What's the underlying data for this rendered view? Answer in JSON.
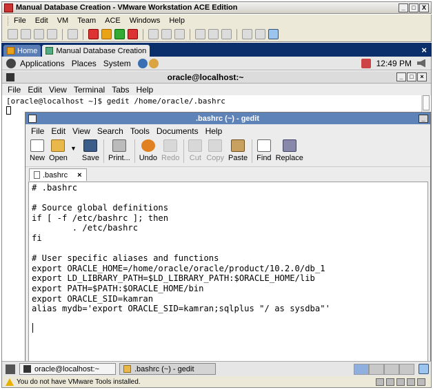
{
  "vmware": {
    "title": "Manual Database Creation - VMware Workstation ACE Edition",
    "window_controls": [
      "_",
      "□",
      "X"
    ],
    "menu": [
      "File",
      "Edit",
      "VM",
      "Team",
      "ACE",
      "Windows",
      "Help"
    ],
    "tabs": [
      {
        "label": "Home"
      },
      {
        "label": "Manual Database Creation"
      }
    ],
    "tab_close": "×",
    "status_message": "You do not have VMware Tools installed."
  },
  "gnome_panel": {
    "menus": [
      "Applications",
      "Places",
      "System"
    ],
    "clock": "12:49 PM"
  },
  "terminal": {
    "title": "oracle@localhost:~",
    "window_controls": [
      "_",
      "□",
      "×"
    ],
    "menu": [
      "File",
      "Edit",
      "View",
      "Terminal",
      "Tabs",
      "Help"
    ],
    "prompt_line": "[oracle@localhost ~]$ gedit /home/oracle/.bashrc"
  },
  "gedit": {
    "title": ".bashrc (~) - gedit",
    "minimize": "_",
    "menu": [
      "File",
      "Edit",
      "View",
      "Search",
      "Tools",
      "Documents",
      "Help"
    ],
    "toolbar": {
      "new": "New",
      "open": "Open",
      "open_dropdown": "▼",
      "save": "Save",
      "print": "Print...",
      "undo": "Undo",
      "redo": "Redo",
      "cut": "Cut",
      "copy": "Copy",
      "paste": "Paste",
      "find": "Find",
      "replace": "Replace"
    },
    "tab": {
      "label": ".bashrc",
      "close": "×"
    },
    "lines": [
      "# .bashrc",
      "",
      "# Source global definitions",
      "if [ -f /etc/bashrc ]; then",
      "        . /etc/bashrc",
      "fi",
      "",
      "# User specific aliases and functions",
      "export ORACLE_HOME=/home/oracle/oracle/product/10.2.0/db_1",
      "export LD_LIBRARY_PATH=$LD_LIBRARY_PATH:$ORACLE_HOME/lib",
      "export PATH=$PATH:$ORACLE_HOME/bin",
      "export ORACLE_SID=kamran",
      "alias mydb='export ORACLE_SID=kamran;sqlplus \"/ as sysdba\"'"
    ]
  },
  "taskbar": {
    "items": [
      {
        "label": "oracle@localhost:~"
      },
      {
        "label": ".bashrc (~) - gedit"
      }
    ]
  }
}
